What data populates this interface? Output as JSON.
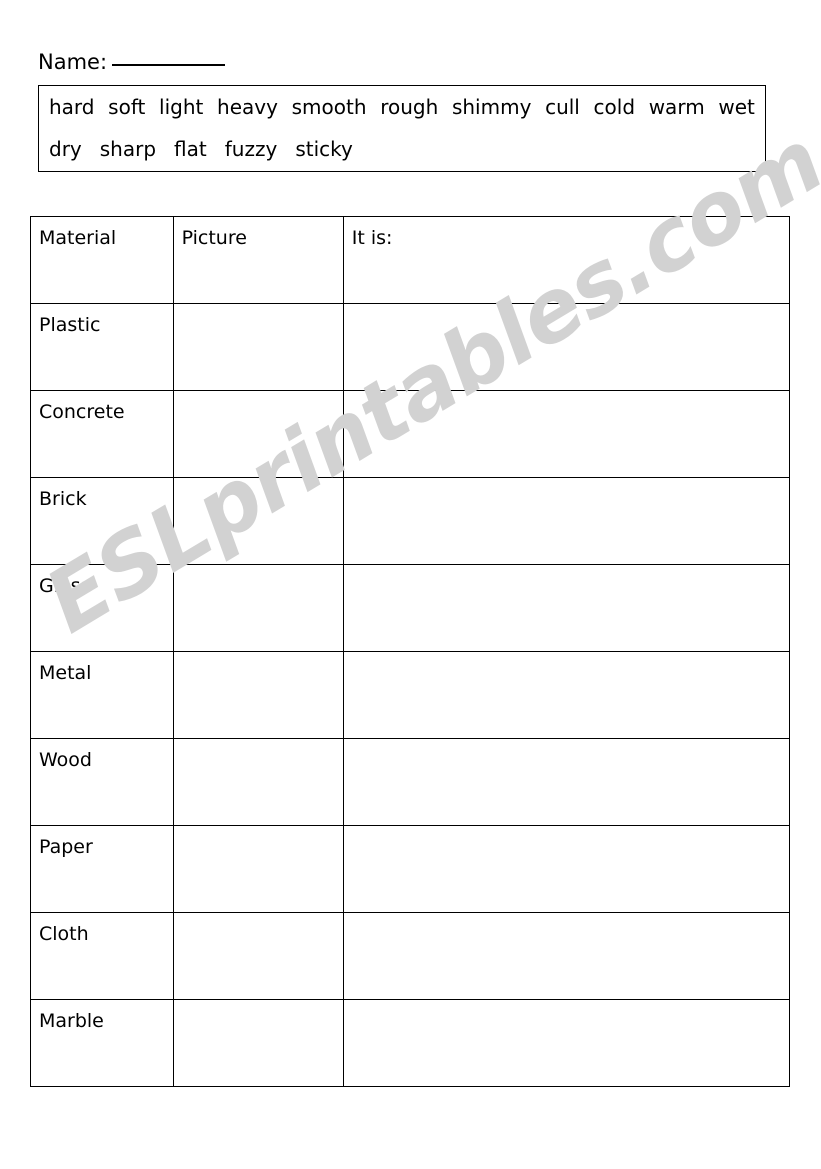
{
  "worksheet": {
    "name_field": {
      "label": "Name:",
      "blank": "_________"
    },
    "word_bank": {
      "rows": [
        [
          "hard",
          "soft",
          "light",
          "heavy",
          "smooth",
          "rough",
          "shimmy",
          "cull",
          "cold",
          "warm",
          "wet"
        ],
        [
          "dry",
          "sharp",
          "flat",
          "fuzzy",
          "sticky"
        ]
      ]
    },
    "table": {
      "headers": [
        "Material",
        "Picture",
        "It is:"
      ],
      "rows": [
        {
          "material": "Plastic",
          "picture": "",
          "it_is": ""
        },
        {
          "material": "Concrete",
          "picture": "",
          "it_is": ""
        },
        {
          "material": "Brick",
          "picture": "",
          "it_is": ""
        },
        {
          "material": "Glass",
          "picture": "",
          "it_is": ""
        },
        {
          "material": "Metal",
          "picture": "",
          "it_is": ""
        },
        {
          "material": "Wood",
          "picture": "",
          "it_is": ""
        },
        {
          "material": "Paper",
          "picture": "",
          "it_is": ""
        },
        {
          "material": "Cloth",
          "picture": "",
          "it_is": ""
        },
        {
          "material": "Marble",
          "picture": "",
          "it_is": ""
        }
      ]
    },
    "watermark": {
      "text": "ESLprintables.com",
      "color": "#d2d2d2"
    }
  }
}
